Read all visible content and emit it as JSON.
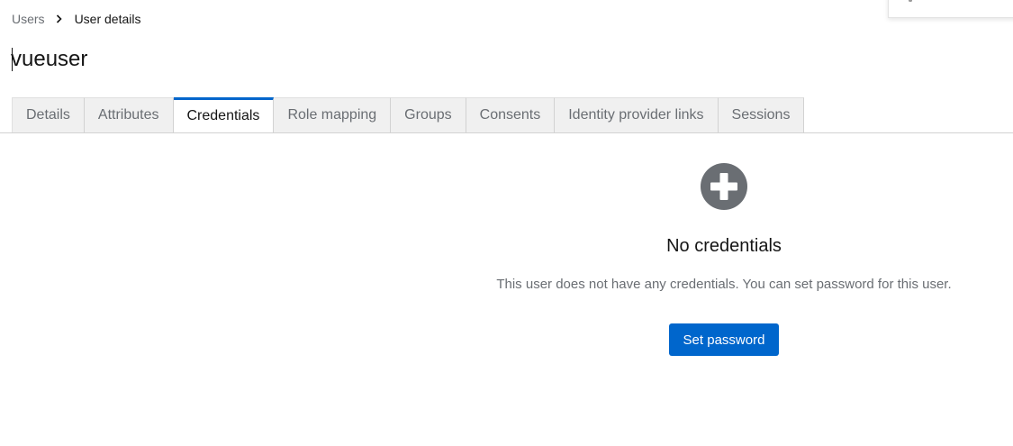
{
  "breadcrumb": {
    "parent": "Users",
    "current": "User details",
    "separator_icon": "chevron-right-icon"
  },
  "page": {
    "title": "vueuser"
  },
  "tabs": [
    {
      "label": "Details",
      "active": false
    },
    {
      "label": "Attributes",
      "active": false
    },
    {
      "label": "Credentials",
      "active": true
    },
    {
      "label": "Role mapping",
      "active": false
    },
    {
      "label": "Groups",
      "active": false
    },
    {
      "label": "Consents",
      "active": false
    },
    {
      "label": "Identity provider links",
      "active": false
    },
    {
      "label": "Sessions",
      "active": false
    }
  ],
  "empty_state": {
    "icon": "plus-circle-icon",
    "title": "No credentials",
    "body": "This user does not have any credentials. You can set password for this user.",
    "action_label": "Set password"
  },
  "colors": {
    "accent": "#0066cc",
    "icon_gray": "#6a6e73",
    "tab_bg": "#f0f0f0",
    "muted_text": "#6a6e73"
  }
}
